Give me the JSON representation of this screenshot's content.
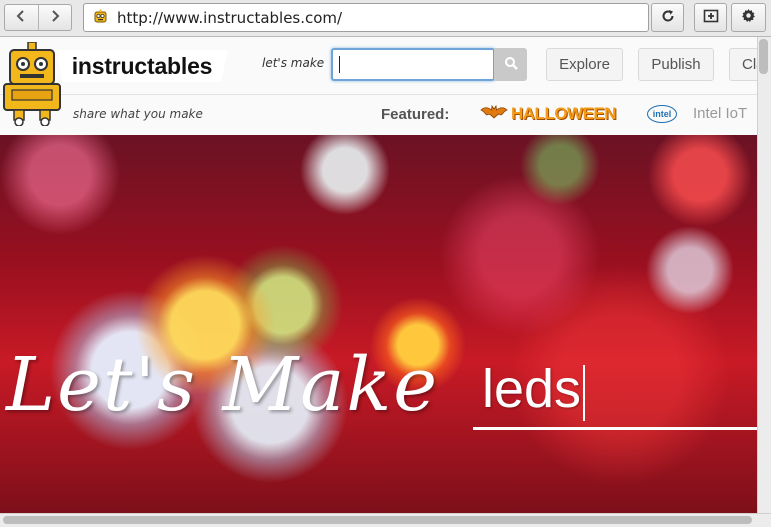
{
  "browser": {
    "url": "http://www.instructables.com/",
    "back_icon": "chevron-left-icon",
    "forward_icon": "chevron-right-icon",
    "reload_icon": "reload-icon",
    "tab_icon": "new-tab-icon",
    "settings_icon": "gear-icon"
  },
  "header": {
    "brand": "instructables",
    "lets_make_label": "let's make",
    "search_value": "",
    "nav": [
      "Explore",
      "Publish",
      "Cla"
    ]
  },
  "featured": {
    "tagline": "share what you make",
    "label": "Featured:",
    "halloween": "HALLOWEEN",
    "intel_logo": "intel",
    "intel": "Intel IoT"
  },
  "hero": {
    "script_text": "Let's Make",
    "input_value": "leds"
  },
  "colors": {
    "accent": "#f39a16",
    "hero_base": "#9b1020",
    "focus": "#6ea4d8"
  }
}
